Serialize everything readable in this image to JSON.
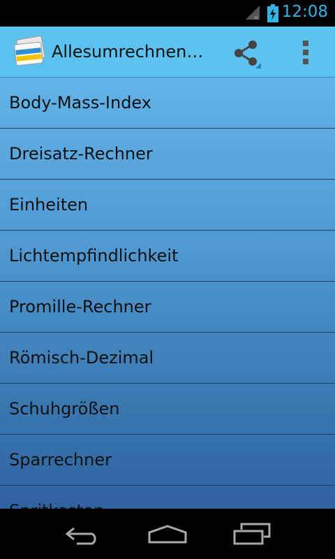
{
  "status_bar": {
    "time": "12:08",
    "icons": [
      "signal-icon",
      "battery-charging-icon"
    ],
    "accent": "#33b5e5"
  },
  "action_bar": {
    "title": "Allesumrechnen…",
    "icons": [
      "app-logo-icon",
      "share-icon",
      "overflow-menu-icon"
    ],
    "background": "#5cc3f0"
  },
  "list": {
    "items": [
      {
        "label": "Body-Mass-Index"
      },
      {
        "label": "Dreisatz-Rechner"
      },
      {
        "label": "Einheiten"
      },
      {
        "label": "Lichtempfindlichkeit"
      },
      {
        "label": "Promille-Rechner"
      },
      {
        "label": "Römisch-Dezimal"
      },
      {
        "label": "Schuhgrößen"
      },
      {
        "label": "Sparrechner"
      },
      {
        "label": "Spritkosten"
      }
    ]
  },
  "nav_bar": {
    "icons": [
      "back-icon",
      "home-icon",
      "recent-apps-icon"
    ]
  }
}
